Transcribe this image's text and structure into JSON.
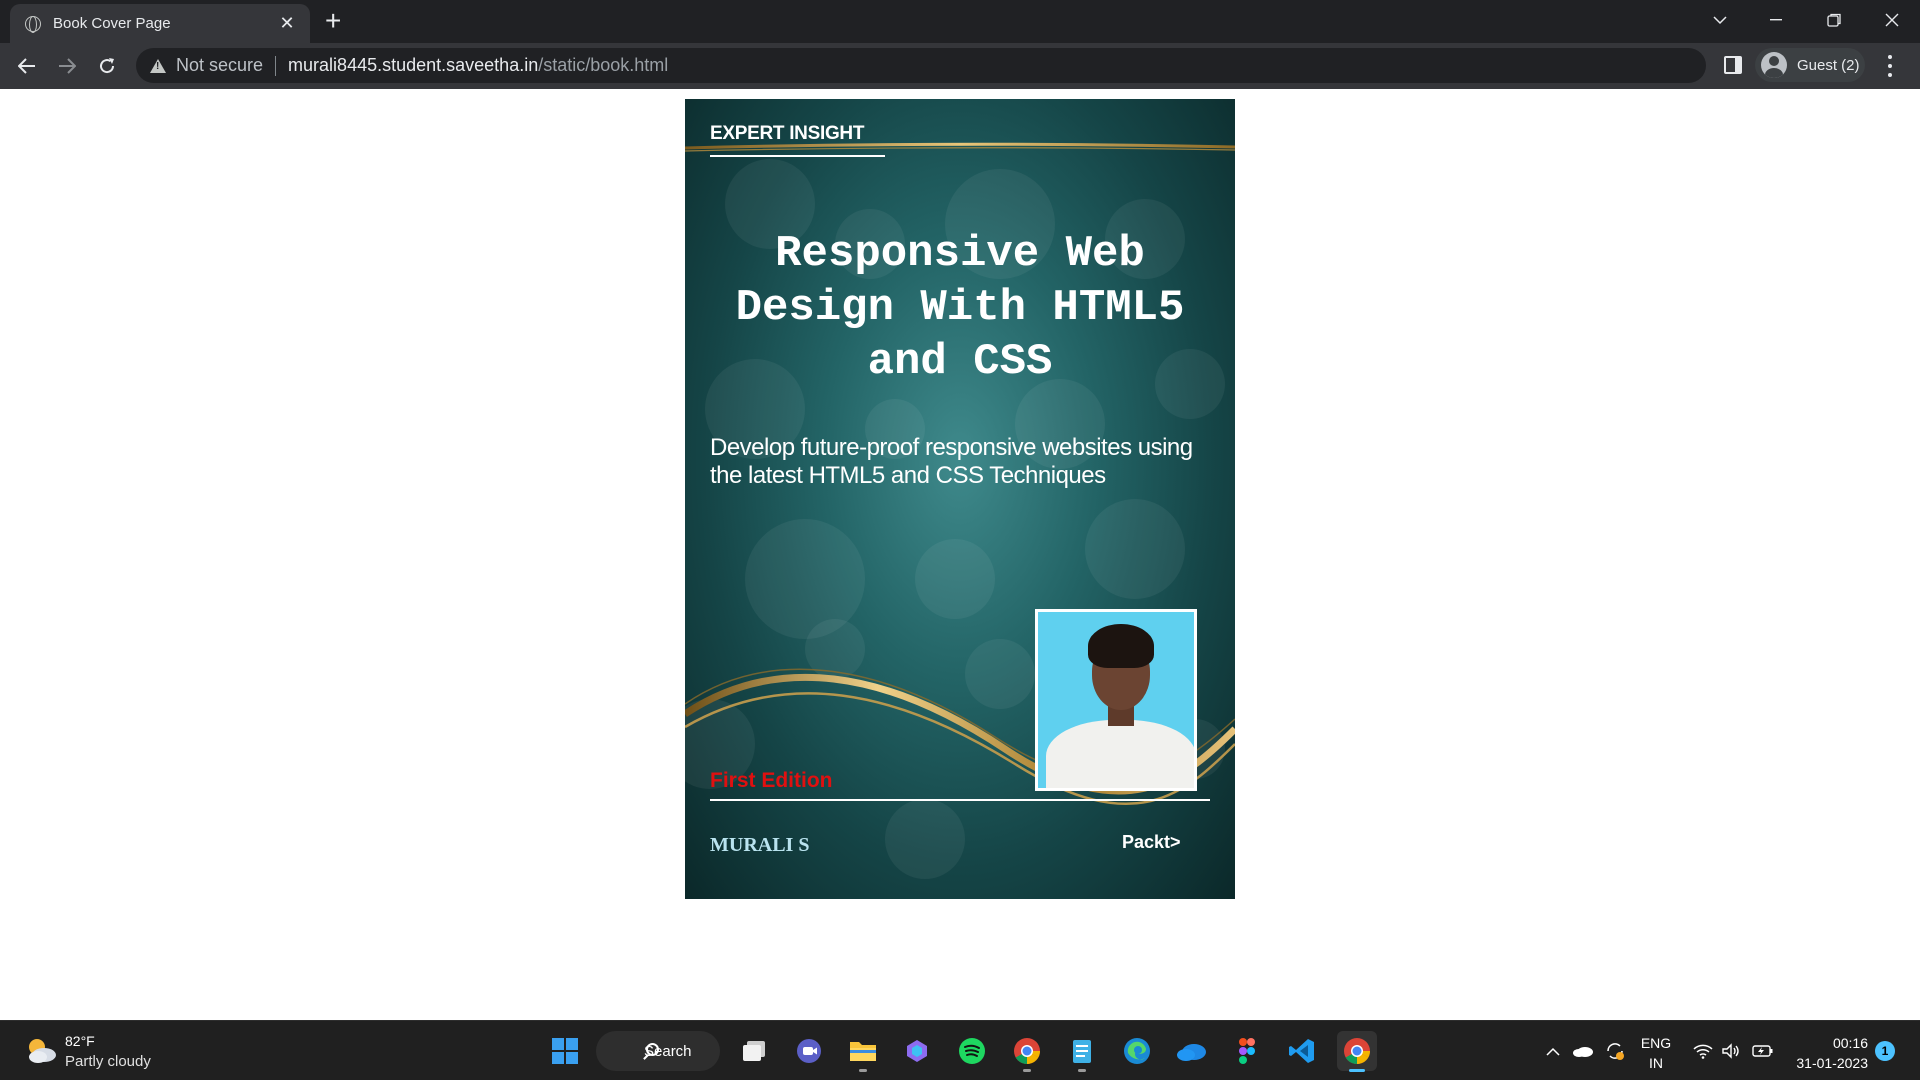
{
  "browser": {
    "tab_title": "Book Cover Page",
    "tab_close": "✕",
    "new_tab": "+",
    "security_label": "Not secure",
    "url_host": "murali8445.student.saveetha.in",
    "url_path": "/static/book.html",
    "profile_label": "Guest (2)"
  },
  "cover": {
    "series_label": "EXPERT INSIGHT",
    "title": "Responsive Web Design With HTML5 and CSS",
    "subtitle": "Develop future-proof responsive websites using the latest HTML5 and CSS Techniques",
    "edition": "First Edition",
    "author": "MURALI S",
    "publisher": "Packt>",
    "colors": {
      "background": "#1f5d5f",
      "gold": "#c9a24a",
      "edition": "#e01010",
      "author": "#b9e3ef"
    }
  },
  "taskbar": {
    "weather_temp": "82°F",
    "weather_desc": "Partly cloudy",
    "search_label": "Search",
    "lang_primary": "ENG",
    "lang_secondary": "IN",
    "time": "00:16",
    "date": "31-01-2023",
    "notification_count": "1",
    "apps": [
      "start-icon",
      "task-view-icon",
      "teams-icon",
      "file-explorer-icon",
      "copilot-icon",
      "spotify-icon",
      "chrome-icon",
      "notepad-icon",
      "edge-icon",
      "onedrive-icon",
      "figma-icon",
      "vscode-icon",
      "chrome-icon"
    ]
  }
}
